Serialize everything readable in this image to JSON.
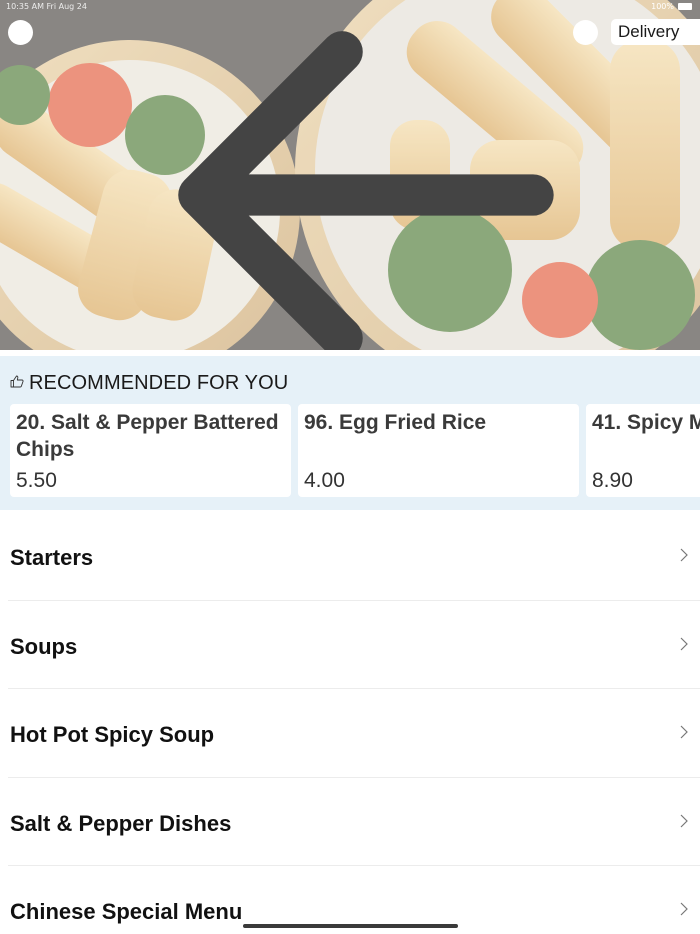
{
  "status_bar": {
    "left_text": "10:35 AM  Fri Aug 24",
    "battery_text": "100%"
  },
  "header": {
    "back_icon": "arrow-left-icon",
    "search_icon": "search-icon",
    "mode_label": "Delivery",
    "mode_chevron_icon": "chevron-down-icon"
  },
  "recommended": {
    "title": "RECOMMENDED FOR YOU",
    "icon": "thumbs-up-icon",
    "items": [
      {
        "name": "20. Salt & Pepper Battered Chips",
        "price": "5.50"
      },
      {
        "name": "96. Egg Fried Rice",
        "price": "4.00"
      },
      {
        "name": "41. Spicy M",
        "price": "8.90"
      }
    ]
  },
  "categories": [
    {
      "label": "Starters"
    },
    {
      "label": "Soups"
    },
    {
      "label": "Hot Pot Spicy Soup"
    },
    {
      "label": "Salt & Pepper Dishes"
    },
    {
      "label": "Chinese Special Menu"
    }
  ],
  "colors": {
    "recommended_bg": "#e6f1f8",
    "divider": "#ececec",
    "text": "#1a1a1a"
  }
}
